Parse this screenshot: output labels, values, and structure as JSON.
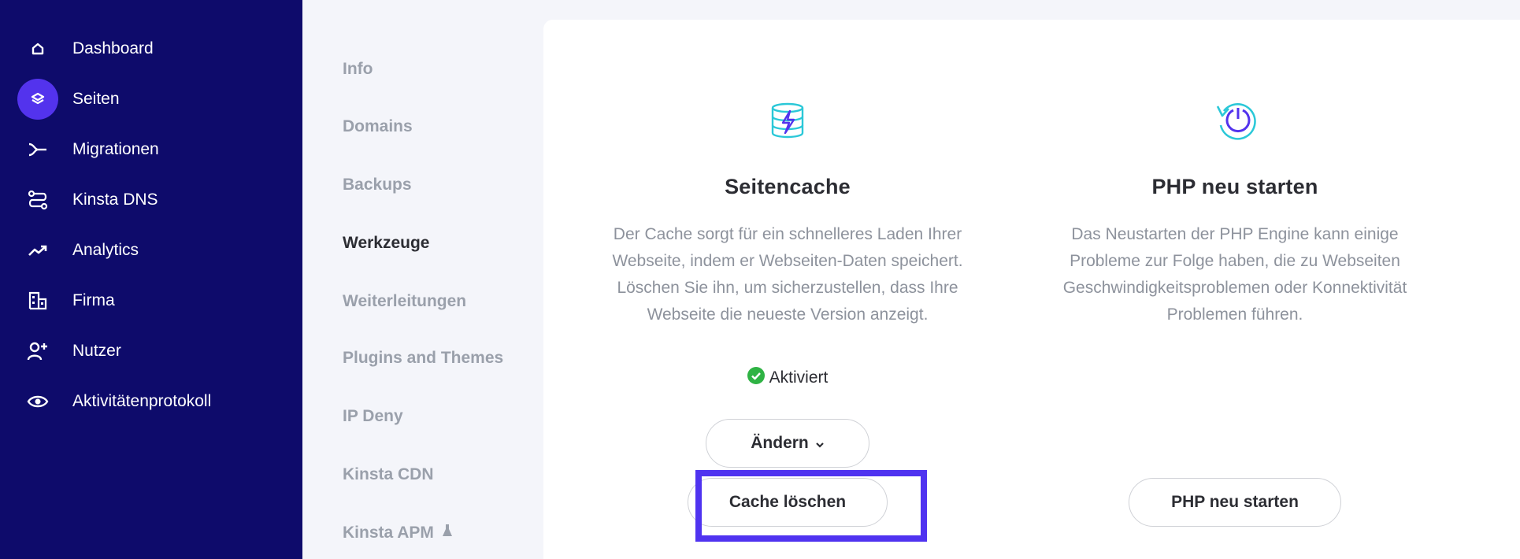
{
  "sidebar": {
    "items": [
      {
        "label": "Dashboard",
        "icon": "home-icon"
      },
      {
        "label": "Seiten",
        "icon": "layers-icon",
        "active": true
      },
      {
        "label": "Migrationen",
        "icon": "migration-icon"
      },
      {
        "label": "Kinsta DNS",
        "icon": "dns-icon"
      },
      {
        "label": "Analytics",
        "icon": "trend-icon"
      },
      {
        "label": "Firma",
        "icon": "building-icon"
      },
      {
        "label": "Nutzer",
        "icon": "add-user-icon"
      },
      {
        "label": "Aktivitätenprotokoll",
        "icon": "eye-icon"
      }
    ]
  },
  "subnav": {
    "items": [
      {
        "label": "Info"
      },
      {
        "label": "Domains"
      },
      {
        "label": "Backups"
      },
      {
        "label": "Werkzeuge",
        "active": true
      },
      {
        "label": "Weiterleitungen"
      },
      {
        "label": "Plugins and Themes"
      },
      {
        "label": "IP Deny"
      },
      {
        "label": "Kinsta CDN"
      },
      {
        "label": "Kinsta APM",
        "icon": "flask-icon"
      }
    ]
  },
  "cache_panel": {
    "title": "Seitencache",
    "description": "Der Cache sorgt für ein schnelleres Laden Ihrer Webseite, indem er Webseiten-Daten speichert. Löschen Sie ihn, um sicherzustellen, dass Ihre Webseite die neueste Version anzeigt.",
    "status": "Aktiviert",
    "change_button": "Ändern",
    "clear_button": "Cache löschen"
  },
  "php_panel": {
    "title": "PHP neu starten",
    "description": "Das Neustarten der PHP Engine kann einige Probleme zur Folge haben, die zu Webseiten Geschwindigkeitsproblemen oder Konnektivität Problemen führen.",
    "restart_button": "PHP neu starten"
  },
  "colors": {
    "sidebar_bg": "#0e0b6b",
    "accent": "#5333ed",
    "highlight": "#4f33f0",
    "success": "#2fb344"
  }
}
